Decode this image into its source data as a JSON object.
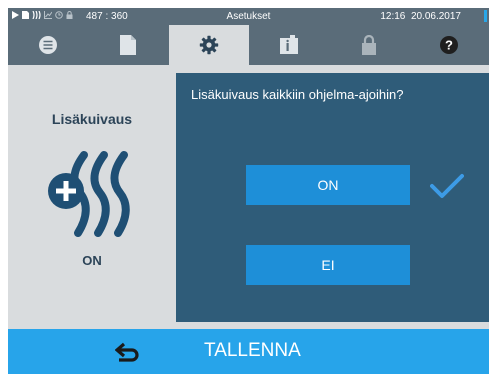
{
  "status_bar": {
    "coordinates": "487 : 360",
    "title": "Asetukset",
    "time": "12:16",
    "date": "20.06.2017",
    "icons": [
      "play-icon",
      "document-icon",
      "drying-icon",
      "chart-icon",
      "clock-icon",
      "lock-icon"
    ]
  },
  "tabs": [
    {
      "icon": "menu-list-icon",
      "active": false
    },
    {
      "icon": "document-icon",
      "active": false
    },
    {
      "icon": "gear-icon",
      "active": true
    },
    {
      "icon": "info-book-icon",
      "active": false
    },
    {
      "icon": "lock-icon",
      "active": false
    },
    {
      "icon": "help-icon",
      "active": false
    }
  ],
  "left_panel": {
    "title": "Lisäkuivaus",
    "state": "ON",
    "symbol": "extra-drying-icon"
  },
  "dialog": {
    "question": "Lisäkuivaus kaikkiin ohjelma-ajoihin?",
    "options": [
      {
        "label": "ON",
        "selected": true
      },
      {
        "label": "EI",
        "selected": false
      }
    ]
  },
  "footer": {
    "back_icon": "back-arrow-icon",
    "save_label": "TALLENNA"
  },
  "colors": {
    "header": "#5a6c79",
    "dialog": "#2f5c79",
    "button": "#1e8fd8",
    "footer": "#27a4ea",
    "checkmark": "#3d9be6",
    "panel_text": "#2c4458"
  }
}
